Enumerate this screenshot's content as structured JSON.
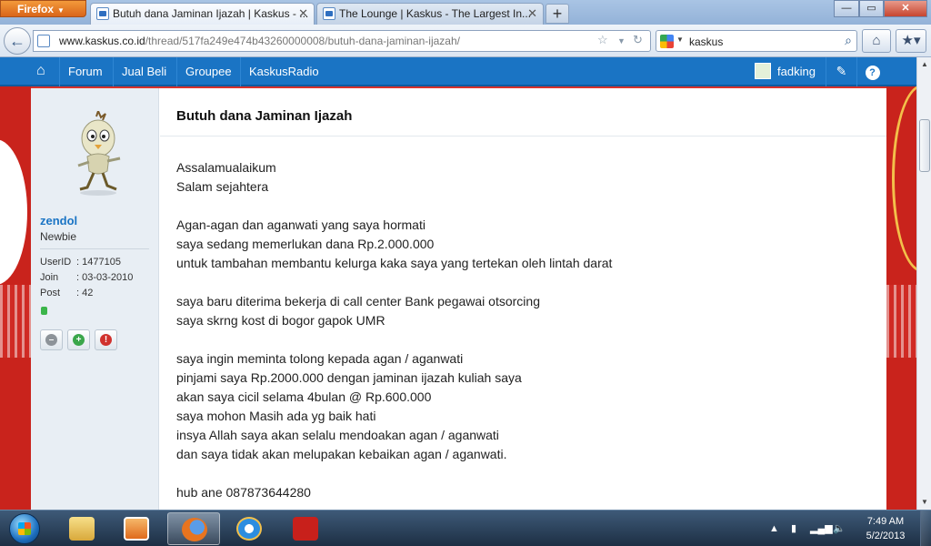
{
  "browser": {
    "menu_button": "Firefox",
    "tabs": [
      {
        "title": "Butuh dana Jaminan Ijazah | Kaskus - ...",
        "active": true
      },
      {
        "title": "The Lounge | Kaskus - The Largest In...",
        "active": false
      }
    ],
    "new_tab_label": "+",
    "url_domain": "www.kaskus.co.id",
    "url_path": "/thread/517fa249e474b43260000008/butuh-dana-jaminan-ijazah/",
    "search_text": "kaskus",
    "window_controls": {
      "minimize": "—",
      "maximize": "▭",
      "close": "✕"
    }
  },
  "kaskus_nav": {
    "items": [
      "Forum",
      "Jual Beli",
      "Groupee",
      "KaskusRadio"
    ],
    "username": "fadking"
  },
  "poster": {
    "name": "zendol",
    "rank": "Newbie",
    "stats": [
      {
        "key": "UserID",
        "value": ": 1477105"
      },
      {
        "key": "Join",
        "value": ": 03-03-2010"
      },
      {
        "key": "Post",
        "value": ": 42"
      }
    ]
  },
  "post": {
    "title": "Butuh dana Jaminan Ijazah",
    "lines": [
      "Assalamualaikum",
      "Salam sejahtera",
      "",
      "Agan-agan dan aganwati yang saya hormati",
      "saya sedang memerlukan dana Rp.2.000.000",
      "untuk tambahan membantu kelurga kaka saya yang tertekan oleh lintah darat",
      "",
      "saya baru diterima bekerja di call center Bank pegawai otsorcing",
      "saya skrng kost di bogor gapok UMR",
      "",
      "saya ingin meminta tolong kepada agan / aganwati",
      "pinjami saya Rp.2000.000 dengan jaminan ijazah kuliah saya",
      "akan saya cicil selama 4bulan @ Rp.600.000",
      "saya mohon Masih ada yg baik hati",
      "insya Allah saya akan selalu mendoakan agan / aganwati",
      "dan saya tidak akan melupakan kebaikan agan / aganwati.",
      "",
      "hub ane 087873644280"
    ]
  },
  "taskbar": {
    "time": "7:49 AM",
    "date": "5/2/2013"
  },
  "colors": {
    "kaskus_blue": "#1a74c4",
    "page_red": "#d8322b"
  }
}
